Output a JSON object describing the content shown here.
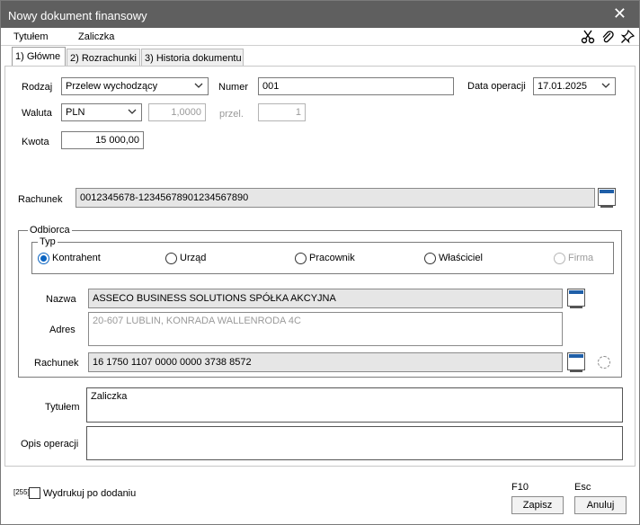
{
  "window": {
    "title": "Nowy dokument finansowy"
  },
  "infobar": {
    "tytul_label": "Tytułem",
    "tytul_value": "Zaliczka"
  },
  "tabs": [
    {
      "label": "1) Główne"
    },
    {
      "label": "2) Rozrachunki"
    },
    {
      "label": "3) Historia dokumentu"
    }
  ],
  "form": {
    "rodzaj_label": "Rodzaj",
    "rodzaj_value": "Przelew wychodzący",
    "numer_label": "Numer",
    "numer_value": "001",
    "data_label": "Data operacji",
    "data_value": "17.01.2025",
    "waluta_label": "Waluta",
    "waluta_value": "PLN",
    "kurs_value": "1,0000",
    "przel_label": "przel.",
    "przel_value": "1",
    "kwota_label": "Kwota",
    "kwota_value": "15 000,00",
    "rachunek_label": "Rachunek",
    "rachunek_value": "0012345678-12345678901234567890"
  },
  "odbiorca": {
    "legend": "Odbiorca",
    "typ_legend": "Typ",
    "types": [
      "Kontrahent",
      "Urząd",
      "Pracownik",
      "Właściciel",
      "Firma"
    ],
    "nazwa_label": "Nazwa",
    "nazwa_value": "ASSECO BUSINESS SOLUTIONS SPÓŁKA AKCYJNA",
    "adres_label": "Adres",
    "adres_value": "20-607 LUBLIN, KONRADA WALLENRODA 4C",
    "rachunek_label": "Rachunek",
    "rachunek_value": "16 1750 1107 0000 0000 3738 8572"
  },
  "tytulem": {
    "label": "Tytułem",
    "value": "Zaliczka"
  },
  "opis": {
    "label": "Opis operacji",
    "value": ""
  },
  "footer": {
    "counter": "[255]",
    "print_label": "Wydrukuj po dodaniu",
    "save_key": "F10",
    "save_label": "Zapisz",
    "cancel_key": "Esc",
    "cancel_label": "Anuluj"
  },
  "colors": {
    "titlebar": "#5f5f5f",
    "accent": "#0a64c2",
    "field_grey": "#e6e6e6"
  },
  "icons": [
    "close-icon",
    "scissors-icon",
    "paperclip-icon",
    "pin-icon",
    "chevron-down-icon",
    "lookup-icon"
  ]
}
